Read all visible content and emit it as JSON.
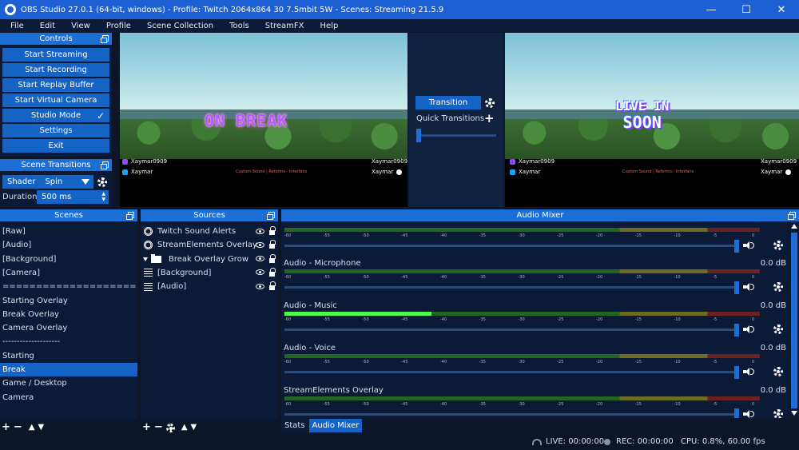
{
  "window": {
    "title": "OBS Studio 27.0.1 (64-bit, windows) - Profile: Twitch 2064x864 30 7.5mbit 5W - Scenes: Streaming 21.5.9",
    "minimize": "—",
    "maximize": "☐",
    "close": "✕"
  },
  "menu": [
    "File",
    "Edit",
    "View",
    "Profile",
    "Scene Collection",
    "Tools",
    "StreamFX",
    "Help"
  ],
  "controls": {
    "header": "Controls",
    "buttons": [
      "Start Streaming",
      "Start Recording",
      "Start Replay Buffer",
      "Start Virtual Camera",
      "Studio Mode",
      "Settings",
      "Exit"
    ],
    "check": "✓"
  },
  "scene_transitions": {
    "header": "Scene Transitions",
    "type_label": "Shader",
    "type_value": "Spin",
    "duration_label": "Duration",
    "duration_value": "500 ms"
  },
  "preview": {
    "left_overlay": "ON BREAK",
    "right_overlay_line1": "LIVE IN",
    "right_overlay_line2": "SOON",
    "handles_left": [
      "Xaymar0909",
      "Xaymar"
    ],
    "handles_right": [
      "Xaymar0909",
      "Xaymar"
    ],
    "credits": "Custom Sound | Reforms - Interface",
    "transition_button": "Transition",
    "quick_transitions": "Quick Transitions"
  },
  "scenes": {
    "header": "Scenes",
    "items": [
      "[Raw]",
      "[Audio]",
      "[Background]",
      "[Camera]",
      "====================",
      "Starting Overlay",
      "Break Overlay",
      "Camera Overlay",
      "--------------------",
      "Starting",
      "Break",
      "Game / Desktop",
      "Camera"
    ],
    "selected": "Break"
  },
  "sources": {
    "header": "Sources",
    "items": [
      {
        "label": "Twitch Sound Alerts",
        "icon": "globe"
      },
      {
        "label": "StreamElements Overlay",
        "icon": "globe"
      },
      {
        "label": "Break Overlay Grow",
        "icon": "folder"
      },
      {
        "label": "[Background]",
        "icon": "list"
      },
      {
        "label": "[Audio]",
        "icon": "list"
      }
    ]
  },
  "audio_mixer": {
    "header": "Audio Mixer",
    "ticks": [
      "-60",
      "-55",
      "-50",
      "-45",
      "-40",
      "-35",
      "-30",
      "-25",
      "-20",
      "-15",
      "-10",
      "-5",
      "0"
    ],
    "channels": [
      {
        "name": "",
        "db": "",
        "level": 0
      },
      {
        "name": "Audio - Microphone",
        "db": "0.0 dB",
        "level": 0
      },
      {
        "name": "Audio - Music",
        "db": "0.0 dB",
        "level": 0.31
      },
      {
        "name": "Audio - Voice",
        "db": "0.0 dB",
        "level": 0
      },
      {
        "name": "StreamElements Overlay",
        "db": "0.0 dB",
        "level": 0
      }
    ]
  },
  "tabs": [
    "Stats",
    "Audio Mixer"
  ],
  "status": {
    "live": "LIVE: 00:00:00",
    "rec": "REC: 00:00:00",
    "cpu": "CPU: 0.8%, 60.00 fps"
  },
  "colors": {
    "accent": "#1b6fd6",
    "button": "#1563c4",
    "panel": "#0b1a36",
    "background": "#0d1628"
  }
}
